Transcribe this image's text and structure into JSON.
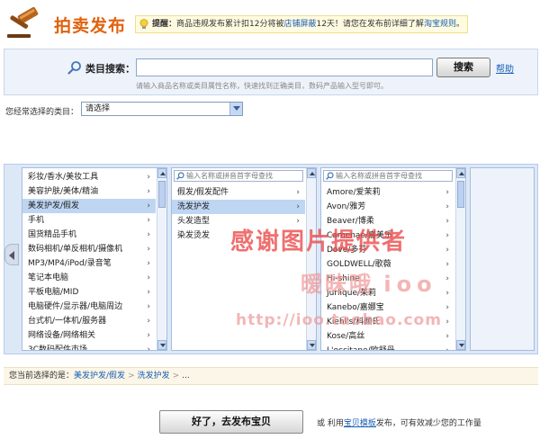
{
  "header": {
    "title": "拍卖发布",
    "notice": {
      "label": "提醒：",
      "text_before": "商品违规发布累计扣12分将被",
      "link1": "店铺屏蔽",
      "text_middle": "12天！请您在发布前详细了解",
      "link2": "淘宝规则",
      "text_after": "。"
    }
  },
  "search": {
    "label": "类目搜索：",
    "value": "",
    "button": "搜索",
    "help": "帮助",
    "hint": "请输入商品名称或类目属性名称，快速找到正确类目，数码产品输入型号即可。"
  },
  "common": {
    "label": "您经常选择的类目：",
    "selected": "请选择"
  },
  "columns": {
    "col1": {
      "items": [
        {
          "label": "彩妆/香水/美妆工具",
          "selected": false
        },
        {
          "label": "美容护肤/美体/精油",
          "selected": false
        },
        {
          "label": "美发护发/假发",
          "selected": true
        },
        {
          "label": "手机",
          "selected": false
        },
        {
          "label": "国货精品手机",
          "selected": false
        },
        {
          "label": "数码相机/单反相机/摄像机",
          "selected": false
        },
        {
          "label": "MP3/MP4/iPod/录音笔",
          "selected": false
        },
        {
          "label": "笔记本电脑",
          "selected": false
        },
        {
          "label": "平板电脑/MID",
          "selected": false
        },
        {
          "label": "电脑硬件/显示器/电脑周边",
          "selected": false
        },
        {
          "label": "台式机/一体机/服务器",
          "selected": false
        },
        {
          "label": "网络设备/网络相关",
          "selected": false
        },
        {
          "label": "3C数码配件市场",
          "selected": false
        }
      ]
    },
    "col2": {
      "search_placeholder": "输入名称或拼音首字母查找",
      "items": [
        {
          "label": "假发/假发配件",
          "selected": false
        },
        {
          "label": "洗发护发",
          "selected": true
        },
        {
          "label": "头发造型",
          "selected": false
        },
        {
          "label": "染发烫发",
          "selected": false
        }
      ]
    },
    "col3": {
      "search_placeholder": "输入名称或拼音首字母查找",
      "items": [
        {
          "label": "Amore/爱茉莉",
          "selected": false
        },
        {
          "label": "Avon/雅芳",
          "selected": false
        },
        {
          "label": "Beaver/博柔",
          "selected": false
        },
        {
          "label": "Camenae/嘉美乐",
          "selected": false
        },
        {
          "label": "Dove/多芬",
          "selected": false
        },
        {
          "label": "GOLDWELL/歌薇",
          "selected": false
        },
        {
          "label": "Hi-shine",
          "selected": false
        },
        {
          "label": "Jurlique/茱莉",
          "selected": false
        },
        {
          "label": "Kanebo/嘉娜宝",
          "selected": false
        },
        {
          "label": "Kiehl's/科颜氏",
          "selected": false
        },
        {
          "label": "Kose/高丝",
          "selected": false
        },
        {
          "label": "L'occitane/欧舒丹",
          "selected": false
        }
      ]
    }
  },
  "path": {
    "label": "您当前选择的是：",
    "crumbs": [
      "美发护发/假发",
      "洗发护发"
    ],
    "sep": ">",
    "tail": "..."
  },
  "footer": {
    "publish_button": "好了，去发布宝贝",
    "template_before": "或 利用",
    "template_link": "宝贝模板",
    "template_after": "发布，可有效减少您的工作量"
  },
  "watermark": {
    "line1": "感谢图片提供者",
    "line2_cn": "暧昧哦",
    "line2_latin": "ioo",
    "line3": "http://ioo.taobao.com"
  },
  "colors": {
    "title_orange": "#e0620e",
    "link_blue": "#1a5fb4",
    "selected_row": "#bfd6f3",
    "watermark_red": "#eb4646"
  }
}
